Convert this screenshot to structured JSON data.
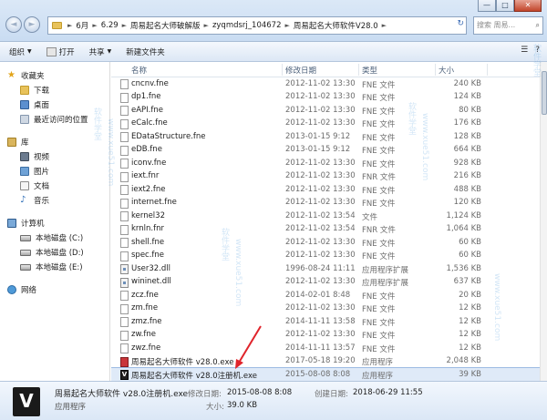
{
  "window": {
    "minimize_glyph": "—",
    "maximize_glyph": "□",
    "close_glyph": "✕"
  },
  "nav": {
    "back_glyph": "◄",
    "forward_glyph": "►"
  },
  "address": {
    "crumbs": [
      "6月",
      "6.29",
      "周易起名大师破解版",
      "zyqmdsrj_104672",
      "周易起名大师软件V28.0"
    ],
    "separator": "►",
    "refresh_glyph": "↻"
  },
  "search": {
    "placeholder": "搜索 周易...",
    "glyph": "⌕"
  },
  "toolbar": {
    "organize": "组织",
    "open": "打开",
    "share": "共享",
    "new_folder": "新建文件夹",
    "caret": "▼",
    "view_glyph": "☰",
    "help_glyph": "?"
  },
  "sidebar": {
    "favorites": "收藏夹",
    "downloads": "下载",
    "desktop": "桌面",
    "recent": "最近访问的位置",
    "libraries": "库",
    "videos": "视频",
    "pictures": "图片",
    "documents": "文档",
    "music": "音乐",
    "computer": "计算机",
    "disk_c": "本地磁盘 (C:)",
    "disk_d": "本地磁盘 (D:)",
    "disk_e": "本地磁盘 (E:)",
    "network": "网络"
  },
  "columns": {
    "name": "名称",
    "date": "修改日期",
    "type": "类型",
    "size": "大小",
    "sort_glyph": "^"
  },
  "files": [
    {
      "name": "cncnv.fne",
      "date": "2012-11-02 13:30",
      "type": "FNE 文件",
      "size": "240 KB",
      "icon": "file"
    },
    {
      "name": "dp1.fne",
      "date": "2012-11-02 13:30",
      "type": "FNE 文件",
      "size": "124 KB",
      "icon": "file"
    },
    {
      "name": "eAPI.fne",
      "date": "2012-11-02 13:30",
      "type": "FNE 文件",
      "size": "80 KB",
      "icon": "file"
    },
    {
      "name": "eCalc.fne",
      "date": "2012-11-02 13:30",
      "type": "FNE 文件",
      "size": "176 KB",
      "icon": "file"
    },
    {
      "name": "EDataStructure.fne",
      "date": "2013-01-15 9:12",
      "type": "FNE 文件",
      "size": "128 KB",
      "icon": "file"
    },
    {
      "name": "eDB.fne",
      "date": "2013-01-15 9:12",
      "type": "FNE 文件",
      "size": "664 KB",
      "icon": "file"
    },
    {
      "name": "iconv.fne",
      "date": "2012-11-02 13:30",
      "type": "FNE 文件",
      "size": "928 KB",
      "icon": "file"
    },
    {
      "name": "iext.fnr",
      "date": "2012-11-02 13:30",
      "type": "FNR 文件",
      "size": "216 KB",
      "icon": "file"
    },
    {
      "name": "iext2.fne",
      "date": "2012-11-02 13:30",
      "type": "FNE 文件",
      "size": "488 KB",
      "icon": "file"
    },
    {
      "name": "internet.fne",
      "date": "2012-11-02 13:30",
      "type": "FNE 文件",
      "size": "120 KB",
      "icon": "file"
    },
    {
      "name": "kernel32",
      "date": "2012-11-02 13:54",
      "type": "文件",
      "size": "1,124 KB",
      "icon": "file"
    },
    {
      "name": "krnln.fnr",
      "date": "2012-11-02 13:54",
      "type": "FNR 文件",
      "size": "1,064 KB",
      "icon": "file"
    },
    {
      "name": "shell.fne",
      "date": "2012-11-02 13:30",
      "type": "FNE 文件",
      "size": "60 KB",
      "icon": "file"
    },
    {
      "name": "spec.fne",
      "date": "2012-11-02 13:30",
      "type": "FNE 文件",
      "size": "60 KB",
      "icon": "file"
    },
    {
      "name": "User32.dll",
      "date": "1996-08-24 11:11",
      "type": "应用程序扩展",
      "size": "1,536 KB",
      "icon": "dll"
    },
    {
      "name": "wininet.dll",
      "date": "2012-11-02 13:30",
      "type": "应用程序扩展",
      "size": "637 KB",
      "icon": "dll"
    },
    {
      "name": "zcz.fne",
      "date": "2014-02-01 8:48",
      "type": "FNE 文件",
      "size": "20 KB",
      "icon": "file"
    },
    {
      "name": "zm.fne",
      "date": "2012-11-02 13:30",
      "type": "FNE 文件",
      "size": "12 KB",
      "icon": "file"
    },
    {
      "name": "zmz.fne",
      "date": "2014-11-11 13:58",
      "type": "FNE 文件",
      "size": "12 KB",
      "icon": "file"
    },
    {
      "name": "zw.fne",
      "date": "2012-11-02 13:30",
      "type": "FNE 文件",
      "size": "12 KB",
      "icon": "file"
    },
    {
      "name": "zwz.fne",
      "date": "2014-11-11 13:57",
      "type": "FNE 文件",
      "size": "12 KB",
      "icon": "file"
    },
    {
      "name": "周易起名大师软件 v28.0.exe",
      "date": "2017-05-18 19:20",
      "type": "应用程序",
      "size": "2,048 KB",
      "icon": "exe-red"
    },
    {
      "name": "周易起名大师软件 v28.0注册机.exe",
      "date": "2015-08-08 8:08",
      "type": "应用程序",
      "size": "39 KB",
      "icon": "exe-v",
      "selected": true
    }
  ],
  "details": {
    "icon_letter": "V",
    "name": "周易起名大师软件 v28.0注册机.exe",
    "kind": "应用程序",
    "modified_label": "修改日期:",
    "modified_value": "2015-08-08 8:08",
    "size_label": "大小:",
    "size_value": "39.0 KB",
    "created_label": "创建日期:",
    "created_value": "2018-06-29 11:55"
  },
  "watermarks": [
    "软件学堂",
    "www.xue51.com",
    "软件学堂",
    "www.xue51.com",
    "软件学堂",
    "www.xue51.com",
    "软件学堂",
    "www.xue51.com"
  ]
}
